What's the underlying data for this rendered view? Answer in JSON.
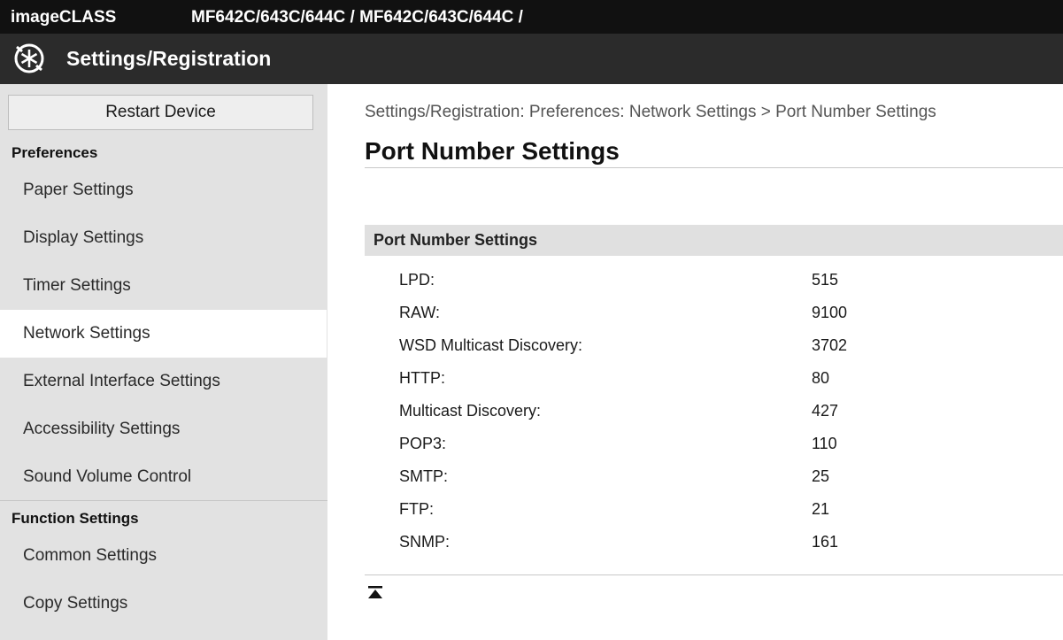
{
  "topbar": {
    "brand": "imageCLASS",
    "model": "MF642C/643C/644C / MF642C/643C/644C /"
  },
  "titlebar": {
    "title": "Settings/Registration",
    "logo_icon": "settings-logo-icon"
  },
  "sidebar": {
    "restart_label": "Restart Device",
    "sections": [
      {
        "heading": "Preferences",
        "items": [
          "Paper Settings",
          "Display Settings",
          "Timer Settings",
          "Network Settings",
          "External Interface Settings",
          "Accessibility Settings",
          "Sound Volume Control"
        ]
      },
      {
        "heading": "Function Settings",
        "items": [
          "Common Settings",
          "Copy Settings"
        ]
      }
    ],
    "active_item": "Network Settings"
  },
  "main": {
    "breadcrumb": "Settings/Registration: Preferences: Network Settings > Port Number Settings",
    "title": "Port Number Settings",
    "panel_heading": "Port Number Settings",
    "rows": [
      {
        "label": "LPD:",
        "value": "515"
      },
      {
        "label": "RAW:",
        "value": "9100"
      },
      {
        "label": "WSD Multicast Discovery:",
        "value": "3702"
      },
      {
        "label": "HTTP:",
        "value": "80"
      },
      {
        "label": "Multicast Discovery:",
        "value": "427"
      },
      {
        "label": "POP3:",
        "value": "110"
      },
      {
        "label": "SMTP:",
        "value": "25"
      },
      {
        "label": "FTP:",
        "value": "21"
      },
      {
        "label": "SNMP:",
        "value": "161"
      }
    ],
    "to_top_icon": "back-to-top-icon"
  },
  "colors": {
    "topbar_bg": "#111111",
    "titlebar_bg": "#2b2b2b",
    "sidebar_bg": "#e2e2e2",
    "active_item_bg": "#ffffff",
    "panel_head_bg": "#e0e0e0"
  }
}
